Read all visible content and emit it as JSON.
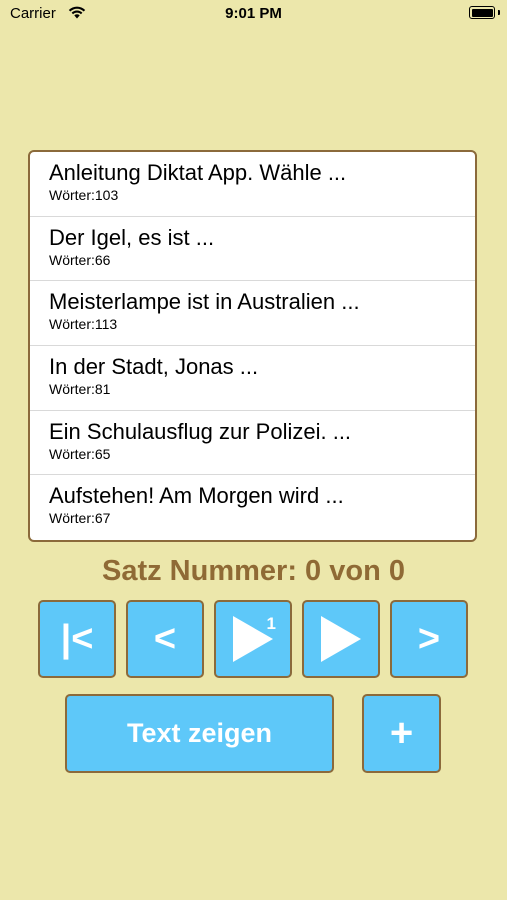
{
  "status_bar": {
    "carrier": "Carrier",
    "time": "9:01 PM"
  },
  "texts": [
    {
      "title": "Anleitung Diktat App. Wähle ...",
      "words": "Wörter:103"
    },
    {
      "title": "Der Igel, es ist ...",
      "words": "Wörter:66"
    },
    {
      "title": "Meisterlampe ist in Australien ...",
      "words": "Wörter:113"
    },
    {
      "title": "In der Stadt, Jonas ...",
      "words": "Wörter:81"
    },
    {
      "title": "Ein Schulausflug zur Polizei. ...",
      "words": "Wörter:65"
    },
    {
      "title": "Aufstehen! Am Morgen wird ...",
      "words": "Wörter:67"
    }
  ],
  "sentence_counter": "Satz Nummer: 0 von 0",
  "controls": {
    "first_label": "|<",
    "prev_label": "<",
    "play_once_badge": "1",
    "next_label": ">",
    "show_text_label": "Text zeigen",
    "add_label": "+"
  },
  "colors": {
    "background": "#ece7ab",
    "button": "#5ec8f9",
    "border": "#8b6a3b",
    "counter": "#8f6a35"
  }
}
